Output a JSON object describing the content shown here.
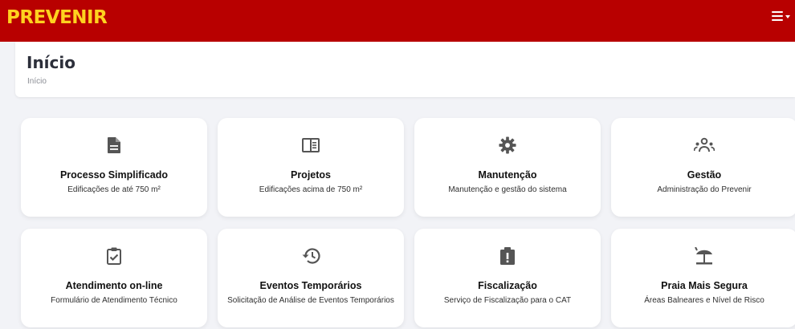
{
  "brand": {
    "name": "PREVENIR"
  },
  "header": {
    "title": "Início",
    "breadcrumb": "Início"
  },
  "colors": {
    "topbar": "#b80000",
    "brand": "#ffd21f",
    "icon": "#555555",
    "background": "#f2f3f7"
  },
  "cards": [
    {
      "title": "Processo Simplificado",
      "subtitle": "Edificações de até 750 m²",
      "icon": "document-icon"
    },
    {
      "title": "Projetos",
      "subtitle": "Edificações acima de 750 m²",
      "icon": "book-icon"
    },
    {
      "title": "Manutenção",
      "subtitle": "Manutenção e gestão do sistema",
      "icon": "gear-icon"
    },
    {
      "title": "Gestão",
      "subtitle": "Administração do Prevenir",
      "icon": "group-icon"
    },
    {
      "title": "Atendimento on-line",
      "subtitle": "Formulário de Atendimento Técnico",
      "icon": "clipboard-check-icon"
    },
    {
      "title": "Eventos Temporários",
      "subtitle": "Solicitação de Análise de Eventos Temporários",
      "icon": "history-icon"
    },
    {
      "title": "Fiscalização",
      "subtitle": "Serviço de Fiscalização para o CAT",
      "icon": "alert-icon"
    },
    {
      "title": "Praia Mais Segura",
      "subtitle": "Áreas Balneares e Nível de Risco",
      "icon": "beach-umbrella-icon"
    }
  ]
}
